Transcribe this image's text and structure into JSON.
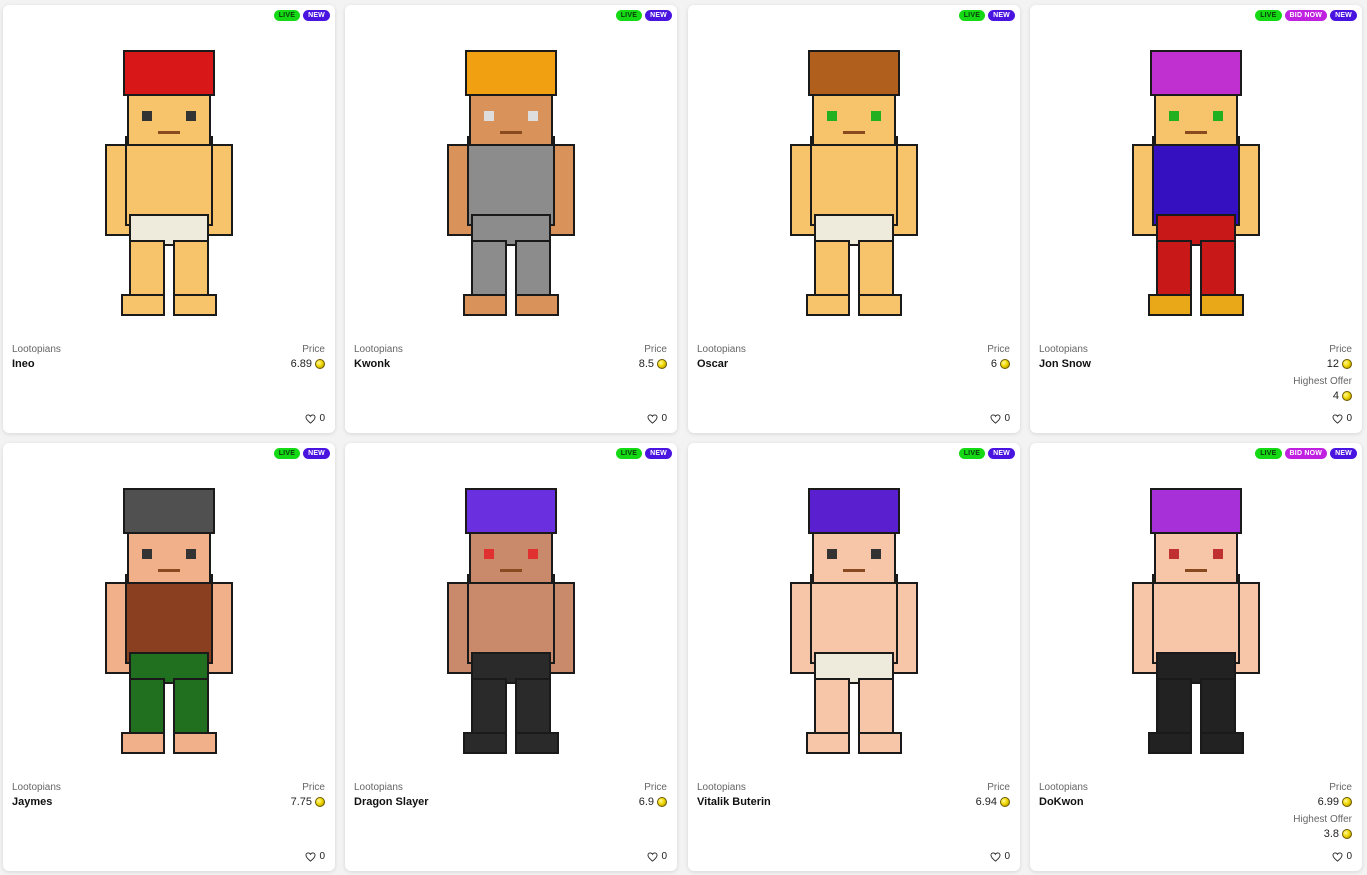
{
  "badges": {
    "live": "LIVE",
    "new": "NEW",
    "bid_now": "BID NOW"
  },
  "labels": {
    "price": "Price",
    "highest_offer": "Highest Offer"
  },
  "cards": [
    {
      "collection": "Lootopians",
      "name": "Ineo",
      "price": "6.89",
      "likes": "0",
      "bid_now": false,
      "highest_offer": "",
      "palette": {
        "hair": "#d81818",
        "skin": "#f7c46c",
        "top": "#f7c46c",
        "bottom": "#eeebdc",
        "feet": "#f7c46c",
        "eyes": "#333333"
      }
    },
    {
      "collection": "Lootopians",
      "name": "Kwonk",
      "price": "8.5",
      "likes": "0",
      "bid_now": false,
      "highest_offer": "",
      "palette": {
        "hair": "#f0a010",
        "skin": "#d9925a",
        "top": "#8c8c8c",
        "bottom": "#8c8c8c",
        "feet": "#d9925a",
        "eyes": "#dddddd"
      }
    },
    {
      "collection": "Lootopians",
      "name": "Oscar",
      "price": "6",
      "likes": "0",
      "bid_now": false,
      "highest_offer": "",
      "palette": {
        "hair": "#b0601c",
        "skin": "#f7c46c",
        "top": "#f7c46c",
        "bottom": "#eeebdc",
        "feet": "#f7c46c",
        "eyes": "#20b020"
      }
    },
    {
      "collection": "Lootopians",
      "name": "Jon Snow",
      "price": "12",
      "likes": "0",
      "bid_now": true,
      "highest_offer": "4",
      "palette": {
        "hair": "#c030d0",
        "skin": "#f7c46c",
        "top": "#3410c0",
        "bottom": "#c81818",
        "feet": "#e8a818",
        "eyes": "#20b020"
      }
    },
    {
      "collection": "Lootopians",
      "name": "Jaymes",
      "price": "7.75",
      "likes": "0",
      "bid_now": false,
      "highest_offer": "",
      "palette": {
        "hair": "#505050",
        "skin": "#f2b08a",
        "top": "#8a4020",
        "bottom": "#207020",
        "feet": "#f2b08a",
        "eyes": "#333333"
      }
    },
    {
      "collection": "Lootopians",
      "name": "Dragon Slayer",
      "price": "6.9",
      "likes": "0",
      "bid_now": false,
      "highest_offer": "",
      "palette": {
        "hair": "#6a30e0",
        "skin": "#c88a6a",
        "top": "#c88a6a",
        "bottom": "#2a2a2a",
        "feet": "#2a2a2a",
        "eyes": "#e03030"
      }
    },
    {
      "collection": "Lootopians",
      "name": "Vitalik Buterin",
      "price": "6.94",
      "likes": "0",
      "bid_now": false,
      "highest_offer": "",
      "palette": {
        "hair": "#5a20d0",
        "skin": "#f7c6a8",
        "top": "#f7c6a8",
        "bottom": "#eeebdc",
        "feet": "#f7c6a8",
        "eyes": "#333333"
      }
    },
    {
      "collection": "Lootopians",
      "name": "DoKwon",
      "price": "6.99",
      "likes": "0",
      "bid_now": true,
      "highest_offer": "3.8",
      "palette": {
        "hair": "#a830d8",
        "skin": "#f7c6a8",
        "top": "#f7c6a8",
        "bottom": "#222222",
        "feet": "#222222",
        "eyes": "#c03030"
      }
    }
  ]
}
